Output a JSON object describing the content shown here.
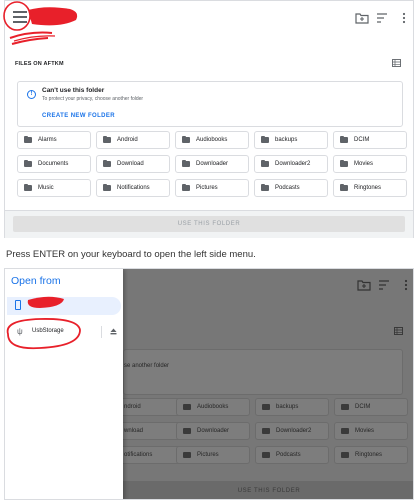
{
  "top_screen": {
    "section_label": "FILES ON AFTKM",
    "warning": {
      "title": "Can't use this folder",
      "subtitle": "To protect your privacy, choose another folder",
      "link": "CREATE NEW FOLDER"
    },
    "folders": [
      "Alarms",
      "Android",
      "Audiobooks",
      "backups",
      "DCIM",
      "Documents",
      "Download",
      "Downloader",
      "Downloader2",
      "Movies",
      "Music",
      "Notifications",
      "Pictures",
      "Podcasts",
      "Ringtones"
    ],
    "use_button": "USE THIS FOLDER",
    "icons": [
      "menu-icon",
      "new-folder-icon",
      "sort-icon",
      "more-vert-icon",
      "grid-view-icon",
      "info-icon",
      "folder-icon"
    ]
  },
  "caption": "Press ENTER on your keyboard to open the left side menu.",
  "bottom_screen": {
    "drawer": {
      "title": "Open from",
      "items": [
        {
          "label": "",
          "icon": "phone-icon",
          "selected": true
        },
        {
          "label": "UsbStorage",
          "icon": "usb-icon",
          "eject_icon": "eject-icon"
        }
      ]
    },
    "dimmed": {
      "warning_subtitle": "se another folder",
      "folders_visible": [
        "ndroid",
        "Audiobooks",
        "backups",
        "DCIM",
        "wnload",
        "Downloader",
        "Downloader2",
        "Movies",
        "otifications",
        "Pictures",
        "Podcasts",
        "Ringtones"
      ],
      "use_button": "USE THIS FOLDER"
    }
  },
  "colors": {
    "accent": "#1a73e8",
    "annotation": "#e8202a",
    "scrim": "#777777"
  }
}
